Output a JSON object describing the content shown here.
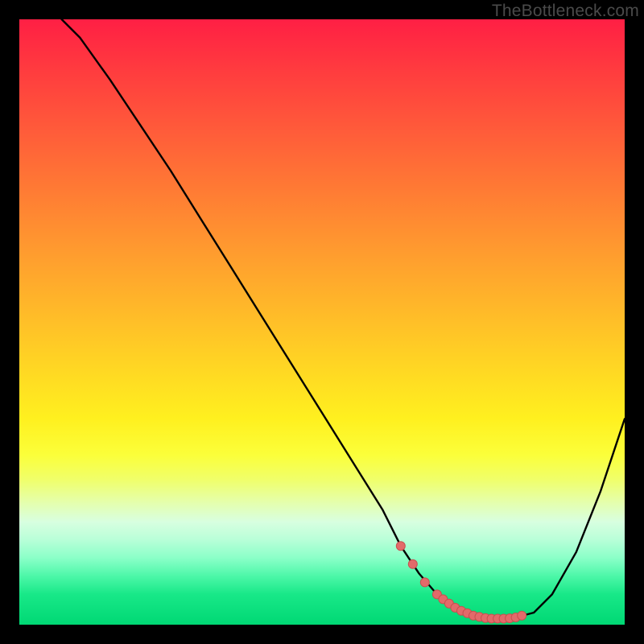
{
  "watermark": "TheBottleneck.com",
  "colors": {
    "background": "#000000",
    "curve_stroke": "#000000",
    "marker_fill": "#e26a6a",
    "marker_stroke": "#c94f4f"
  },
  "chart_data": {
    "type": "line",
    "title": "",
    "xlabel": "",
    "ylabel": "",
    "xlim": [
      0,
      100
    ],
    "ylim": [
      0,
      100
    ],
    "grid": false,
    "legend": false,
    "series": [
      {
        "name": "bottleneck-curve",
        "x": [
          7,
          10,
          15,
          20,
          25,
          30,
          35,
          40,
          45,
          50,
          55,
          60,
          63,
          66,
          69,
          72,
          75,
          78,
          80,
          82,
          85,
          88,
          92,
          96,
          100
        ],
        "y": [
          100,
          97,
          90,
          82.5,
          75,
          67,
          59,
          51,
          43,
          35,
          27,
          19,
          13,
          8.5,
          5,
          2.8,
          1.5,
          1,
          1,
          1.2,
          2,
          5,
          12,
          22,
          34
        ]
      }
    ],
    "markers": {
      "name": "valley-highlight",
      "x": [
        63,
        65,
        67,
        69,
        70,
        71,
        72,
        73,
        74,
        75,
        76,
        77,
        78,
        79,
        80,
        81,
        82,
        83
      ],
      "y": [
        13,
        10,
        7,
        5,
        4.2,
        3.5,
        2.8,
        2.3,
        1.9,
        1.5,
        1.3,
        1.1,
        1,
        1,
        1,
        1.05,
        1.2,
        1.5
      ]
    }
  }
}
